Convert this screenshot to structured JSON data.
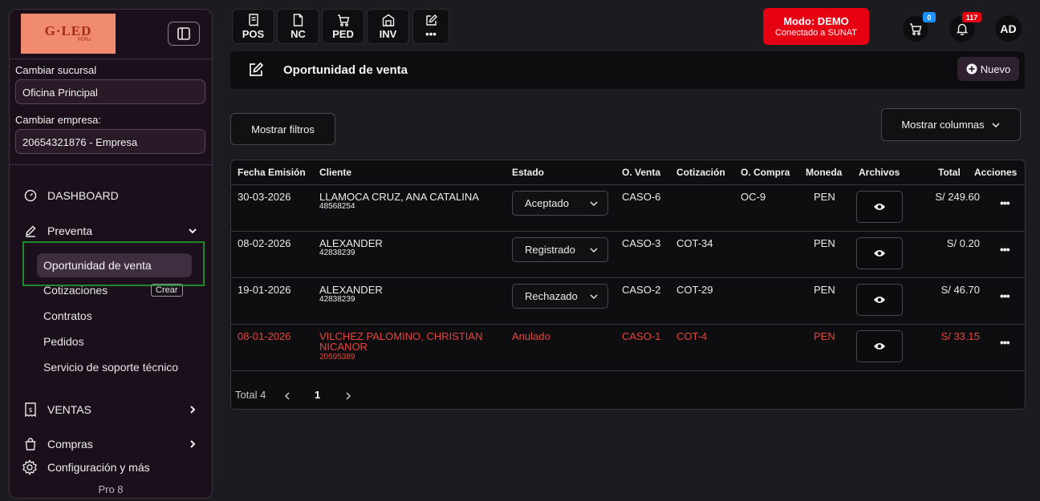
{
  "brand": {
    "logo_text": "G·LED",
    "logo_sub": "PERU"
  },
  "sidebar": {
    "branch_label": "Cambiar sucursal",
    "branch_value": "Oficina Principal",
    "company_label": "Cambiar empresa:",
    "company_value": "20654321876 - Empresa",
    "dashboard": "DASHBOARD",
    "preventa": "Preventa",
    "sub_items": [
      "Oportunidad de venta",
      "Cotizaciones",
      "Contratos",
      "Pedidos",
      "Servicio de soporte técnico"
    ],
    "crear_badge": "Crear",
    "ventas": "VENTAS",
    "compras": "Compras",
    "config": "Configuración y más",
    "plan": "Pro 8"
  },
  "quick_actions": [
    "POS",
    "NC",
    "PED",
    "INV",
    "•••"
  ],
  "mode": {
    "title": "Modo: DEMO",
    "subtitle": "Conectado a SUNAT"
  },
  "cart_count": "0",
  "notifications_count": "117",
  "avatar": "AD",
  "page": {
    "title": "Oportunidad de venta",
    "new_button": "Nuevo"
  },
  "filters_button": "Mostrar filtros",
  "columns_button": "Mostrar columnas",
  "table": {
    "headers": [
      "Fecha Emisión",
      "Cliente",
      "Estado",
      "O. Venta",
      "Cotización",
      "O. Compra",
      "Moneda",
      "Archivos",
      "Total",
      "Acciones"
    ],
    "rows": [
      {
        "fecha": "30-03-2026",
        "cliente": "LLAMOCA CRUZ, ANA CATALINA",
        "cliente_line2": "",
        "doc": "48568254",
        "estado": "Aceptado",
        "oventa": "CASO-6",
        "cotizacion": "",
        "ocompra": "OC-9",
        "moneda": "PEN",
        "total": "S/ 249.60",
        "anulado": false
      },
      {
        "fecha": "08-02-2026",
        "cliente": "ALEXANDER",
        "cliente_line2": "",
        "doc": "42838239",
        "estado": "Registrado",
        "oventa": "CASO-3",
        "cotizacion": "COT-34",
        "ocompra": "",
        "moneda": "PEN",
        "total": "S/ 0.20",
        "anulado": false
      },
      {
        "fecha": "19-01-2026",
        "cliente": "ALEXANDER",
        "cliente_line2": "",
        "doc": "42838239",
        "estado": "Rechazado",
        "oventa": "CASO-2",
        "cotizacion": "COT-29",
        "ocompra": "",
        "moneda": "PEN",
        "total": "S/ 46.70",
        "anulado": false
      },
      {
        "fecha": "08-01-2026",
        "cliente": "VILCHEZ PALOMINO, CHRISTIAN",
        "cliente_line2": "NICANOR",
        "doc": "20595389",
        "estado": "Anulado",
        "oventa": "CASO-1",
        "cotizacion": "COT-4",
        "ocompra": "",
        "moneda": "PEN",
        "total": "S/ 33.15",
        "anulado": true
      }
    ]
  },
  "pagination": {
    "total": "Total 4",
    "current": "1"
  },
  "colors": {
    "accent_red": "#e60012",
    "annulled_red": "#e8453c",
    "active_bg": "#3e2e3f",
    "highlight_green": "#1f8a2a"
  }
}
